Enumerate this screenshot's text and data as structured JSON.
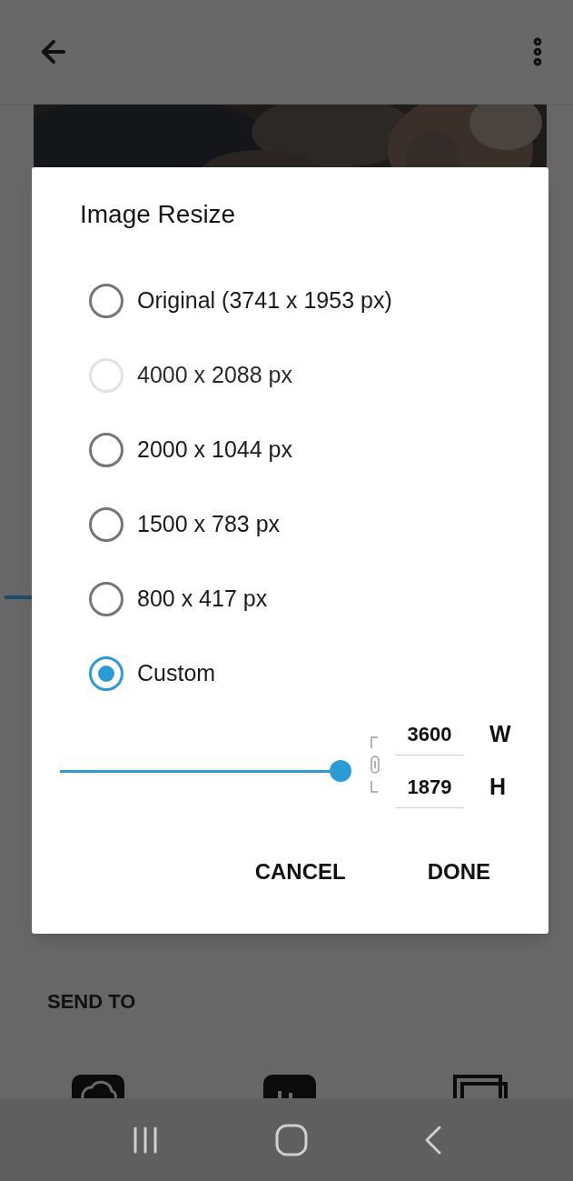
{
  "background": {
    "section_title": "SEND TO"
  },
  "dialog": {
    "title": "Image Resize",
    "options": [
      {
        "label": "Original (3741 x 1953 px)",
        "selected": false,
        "disabled": false
      },
      {
        "label": "4000 x 2088 px",
        "selected": false,
        "disabled": true
      },
      {
        "label": "2000 x 1044 px",
        "selected": false,
        "disabled": false
      },
      {
        "label": "1500 x 783 px",
        "selected": false,
        "disabled": false
      },
      {
        "label": "800 x 417 px",
        "selected": false,
        "disabled": false
      },
      {
        "label": "Custom",
        "selected": true,
        "disabled": false
      }
    ],
    "slider": {
      "level": 1
    },
    "width": {
      "value": "3600",
      "unit": "W"
    },
    "height": {
      "value": "1879",
      "unit": "H"
    },
    "buttons": [
      "CANCEL",
      "DONE"
    ]
  }
}
